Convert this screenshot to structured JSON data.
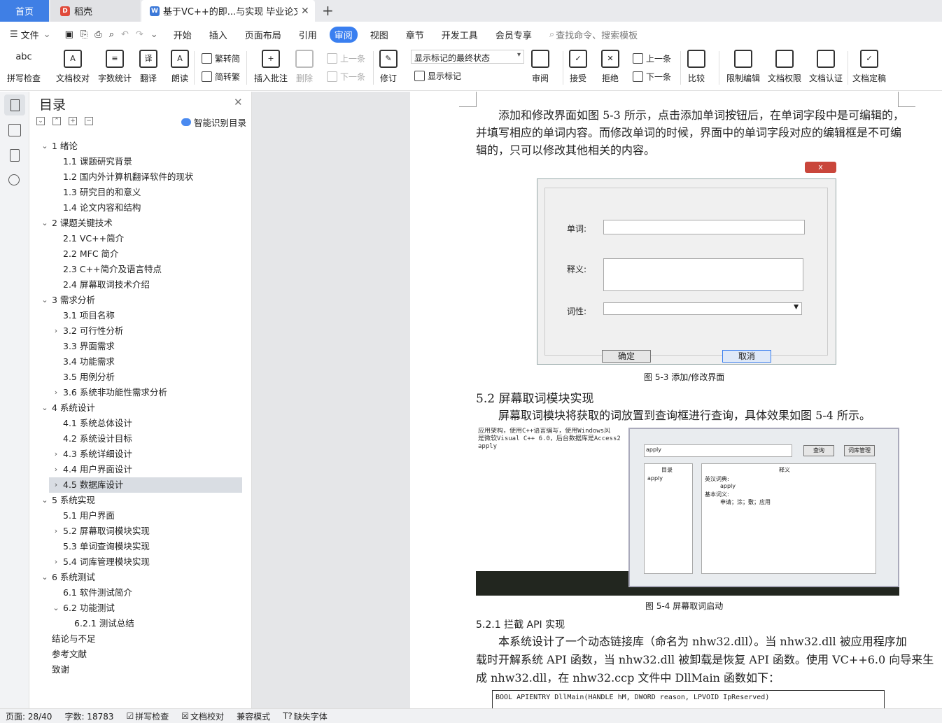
{
  "tabs": {
    "home": "首页",
    "daoke": "稻壳",
    "doc": "基于VC++的即...与实现 毕业论文"
  },
  "menu": {
    "file": "文件",
    "items": [
      "开始",
      "插入",
      "页面布局",
      "引用",
      "审阅",
      "视图",
      "章节",
      "开发工具",
      "会员专享"
    ],
    "active": "审阅",
    "search": "查找命令、搜索模板"
  },
  "ribbon": {
    "spell": "拼写检查",
    "proof": "文档校对",
    "wordcount": "字数统计",
    "translate": "翻译",
    "read": "朗读",
    "trad": "繁转简",
    "simp": "简转繁",
    "comment": "插入批注",
    "delete": "删除",
    "prev_comment": "上一条",
    "next_comment": "下一条",
    "revise": "修订",
    "markup_state": "显示标记的最终状态",
    "show_markup": "显示标记",
    "review": "审阅",
    "accept": "接受",
    "reject": "拒绝",
    "prev": "上一条",
    "next": "下一条",
    "compare": "比较",
    "restrict": "限制编辑",
    "perm": "文档权限",
    "cert": "文档认证",
    "final": "文档定稿"
  },
  "toc": {
    "title": "目录",
    "smart": "智能识别目录",
    "items": [
      {
        "t": "1  绪论",
        "lv": 1,
        "ar": "v"
      },
      {
        "t": "1.1  课题研究背景",
        "lv": 2,
        "ar": ""
      },
      {
        "t": "1.2  国内外计算机翻译软件的现状",
        "lv": 2,
        "ar": ""
      },
      {
        "t": "1.3  研究目的和意义",
        "lv": 2,
        "ar": ""
      },
      {
        "t": "1.4  论文内容和结构",
        "lv": 2,
        "ar": ""
      },
      {
        "t": "2  课题关键技术",
        "lv": 1,
        "ar": "v"
      },
      {
        "t": "2.1  VC++简介",
        "lv": 2,
        "ar": ""
      },
      {
        "t": "2.2  MFC 简介",
        "lv": 2,
        "ar": ""
      },
      {
        "t": "2.3  C++简介及语言特点",
        "lv": 2,
        "ar": ""
      },
      {
        "t": "2.4  屏幕取词技术介绍",
        "lv": 2,
        "ar": ""
      },
      {
        "t": "3  需求分析",
        "lv": 1,
        "ar": "v"
      },
      {
        "t": "3.1  项目名称",
        "lv": 2,
        "ar": ""
      },
      {
        "t": "3.2  可行性分析",
        "lv": 2,
        "ar": ">"
      },
      {
        "t": "3.3  界面需求",
        "lv": 2,
        "ar": ""
      },
      {
        "t": "3.4  功能需求",
        "lv": 2,
        "ar": ""
      },
      {
        "t": "3.5  用例分析",
        "lv": 2,
        "ar": ""
      },
      {
        "t": "3.6  系统非功能性需求分析",
        "lv": 2,
        "ar": ">"
      },
      {
        "t": "4  系统设计",
        "lv": 1,
        "ar": "v"
      },
      {
        "t": "4.1  系统总体设计",
        "lv": 2,
        "ar": ""
      },
      {
        "t": "4.2  系统设计目标",
        "lv": 2,
        "ar": ""
      },
      {
        "t": "4.3  系统详细设计",
        "lv": 2,
        "ar": ">"
      },
      {
        "t": "4.4  用户界面设计",
        "lv": 2,
        "ar": ">"
      },
      {
        "t": "4.5  数据库设计",
        "lv": 2,
        "ar": ">",
        "selected": true
      },
      {
        "t": "5  系统实现",
        "lv": 1,
        "ar": "v"
      },
      {
        "t": "5.1  用户界面",
        "lv": 2,
        "ar": ""
      },
      {
        "t": "5.2  屏幕取词模块实现",
        "lv": 2,
        "ar": ">"
      },
      {
        "t": "5.3  单词查询模块实现",
        "lv": 2,
        "ar": ""
      },
      {
        "t": "5.4  词库管理模块实现",
        "lv": 2,
        "ar": ">"
      },
      {
        "t": "6  系统测试",
        "lv": 1,
        "ar": "v"
      },
      {
        "t": "6.1  软件测试简介",
        "lv": 2,
        "ar": ""
      },
      {
        "t": "6.2  功能测试",
        "lv": 2,
        "ar": "v"
      },
      {
        "t": "6.2.1  测试总结",
        "lv": 3,
        "ar": ""
      },
      {
        "t": "结论与不足",
        "lv": 1,
        "ar": ""
      },
      {
        "t": "参考文献",
        "lv": 1,
        "ar": ""
      },
      {
        "t": "致谢",
        "lv": 1,
        "ar": ""
      }
    ]
  },
  "doc": {
    "p1": [
      "添加和修改界面如图 5-3 所示，点击添加单词按钮后，在单词字段中是可编辑的，",
      "并填写相应的单词内容。而修改单词的时候，界面中的单词字段对应的编辑框是不可编",
      "辑的，只可以修改其他相关的内容。"
    ],
    "dialog": {
      "word": "单词:",
      "meaning": "释义:",
      "pos": "词性:",
      "ok": "确定",
      "cancel": "取消",
      "close": "x"
    },
    "cap1": "图 5-3 添加/修改界面",
    "h52": "5.2   屏幕取词模块实现",
    "p2": "屏幕取词模块将获取的词放置到查询框进行查询，具体效果如图 5-4 所示。",
    "shot": {
      "left_lines": [
        "应用架构，使用C++语言编写，使用Windows风",
        "是微软Visual C++ 6.0，后台数据库是Access2",
        "apply"
      ],
      "query": "apply",
      "btn_query": "查询",
      "btn_manage": "词库管理",
      "col_dir": "目录",
      "col_meaning": "释义",
      "dir_item": "apply",
      "m1": "英汉词典:",
      "m2": "apply",
      "m3": "基本词义:",
      "m4": "申请；涂；敷；应用"
    },
    "cap2": "图 5-4 屏幕取词启动",
    "h521": "5.2.1   拦截 API 实现",
    "p3": [
      "本系统设计了一个动态链接库（命名为 nhw32.dll）。当 nhw32.dll 被应用程序加",
      "载时开解系统 API 函数，当 nhw32.dll 被卸载是恢复 API 函数。使用 VC++6.0 向导来生",
      "成 nhw32.dll，在 nhw32.ccp 文件中 DllMain 函数如下："
    ],
    "code": "BOOL APIENTRY DllMain(HANDLE hM, DWORD reason, LPVOID IpReserved)"
  },
  "status": {
    "page": "页面: 28/40",
    "words": "字数: 18783",
    "spell": "拼写检查",
    "proof": "文档校对",
    "compat": "兼容模式",
    "font": "缺失字体"
  },
  "colors": {
    "accent": "#3a7ff0",
    "home_tab": "#3f7fe5",
    "cancel_btn": "#3a7ff0"
  }
}
